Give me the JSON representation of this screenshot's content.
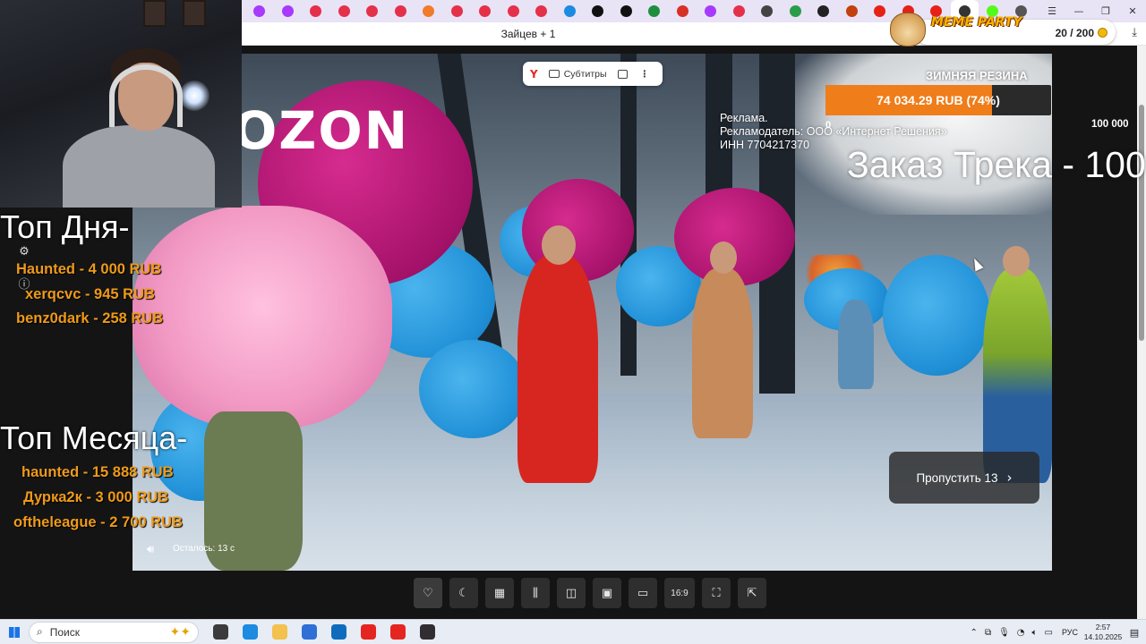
{
  "browser": {
    "window_title": "Зайцев + 1",
    "tabs": [
      {
        "icon": "wildberries-icon",
        "color": "#a73afd"
      },
      {
        "icon": "wildberries-icon",
        "color": "#a73afd"
      },
      {
        "icon": "ozon-icon",
        "color": "#e5304a"
      },
      {
        "icon": "ozon-icon",
        "color": "#e5304a"
      },
      {
        "icon": "ozon-icon",
        "color": "#e5304a"
      },
      {
        "icon": "ozon-icon",
        "color": "#e5304a"
      },
      {
        "icon": "megamarket-icon",
        "color": "#f07c2b"
      },
      {
        "icon": "ozon-icon",
        "color": "#e5304a"
      },
      {
        "icon": "ozon-icon",
        "color": "#e5304a"
      },
      {
        "icon": "ozon-icon",
        "color": "#e5304a"
      },
      {
        "icon": "ozon-icon",
        "color": "#e5304a"
      },
      {
        "icon": "edge-icon",
        "color": "#1c8be0"
      },
      {
        "icon": "circle-icon",
        "color": "#111111"
      },
      {
        "icon": "circle-icon",
        "color": "#111111"
      },
      {
        "icon": "sheets-icon",
        "color": "#1e8e3e"
      },
      {
        "icon": "plus-cross-icon",
        "color": "#d93025"
      },
      {
        "icon": "wildberries-icon",
        "color": "#a73afd"
      },
      {
        "icon": "ozon-icon",
        "color": "#e5304a"
      },
      {
        "icon": "globe-icon",
        "color": "#444444"
      },
      {
        "icon": "check-icon",
        "color": "#2a9d4a"
      },
      {
        "icon": "letter-r-icon",
        "color": "#222222"
      },
      {
        "icon": "chart-icon",
        "color": "#c2410c"
      },
      {
        "icon": "youtube-icon",
        "color": "#e62117"
      },
      {
        "icon": "youtube-icon",
        "color": "#e62117"
      },
      {
        "icon": "youtube-icon",
        "color": "#e62117"
      },
      {
        "icon": "twitch-icon",
        "color": "#333333"
      },
      {
        "icon": "kick-icon",
        "color": "#53fc18"
      },
      {
        "icon": "new-tab-plus-icon",
        "color": "#555555"
      }
    ],
    "window_controls": {
      "menu": "☰",
      "minimize": "—",
      "restore": "❐",
      "close": "✕"
    },
    "download_icon": "⤓"
  },
  "video_controls_top": {
    "subtitles_label": "Субтитры"
  },
  "ad": {
    "brand_logo": "OZON",
    "disclosure_lines": [
      "Реклама.",
      "Рекламодатель: ООО «Интернет Решения»",
      "ИНН 7704217370"
    ],
    "skip_label": "Пропустить 13",
    "remaining_label": "Осталось: 13 с"
  },
  "player_controls": [
    {
      "name": "like-heart-icon",
      "glyph": "♡"
    },
    {
      "name": "night-mode-moon-icon",
      "glyph": "☾"
    },
    {
      "name": "grid-icon",
      "glyph": "▦"
    },
    {
      "name": "audio-wave-icon",
      "glyph": "⫼"
    },
    {
      "name": "mirror-icon",
      "glyph": "◫"
    },
    {
      "name": "picture-in-picture-icon",
      "glyph": "▣"
    },
    {
      "name": "mini-player-icon",
      "glyph": "▭"
    },
    {
      "name": "aspect-ratio-button",
      "glyph": "16:9"
    },
    {
      "name": "fullscreen-icon",
      "glyph": "⛶"
    },
    {
      "name": "open-external-icon",
      "glyph": "⇱"
    }
  ],
  "stream_overlay": {
    "meme_party": {
      "brand": "MEME PARTY",
      "count": "20 / 200"
    },
    "goal": {
      "title": "ЗИМНЯЯ РЕЗИНА",
      "amount_text": "74 034.29 RUB (74%)",
      "progress": 0.74,
      "min_label": "0",
      "max_label": "100 000",
      "fill_color": "#ef7d1a"
    },
    "track_order": "Заказ Трека - 100",
    "top_day": {
      "heading": "Топ Дня-",
      "rows": [
        "Haunted - 4 000 RUB",
        "xerqcvc - 945 RUB",
        "benz0dark - 258 RUB"
      ]
    },
    "top_month": {
      "heading": "Топ Месяца-",
      "rows": [
        "haunted - 15 888 RUB",
        "Дурка2к - 3 000 RUB",
        "oftheleague - 2 700 RUB"
      ]
    },
    "text_color": "#ef9a1a"
  },
  "taskbar": {
    "search_placeholder": "Поиск",
    "apps": [
      {
        "name": "task-view-icon",
        "color": "#3b3b3b"
      },
      {
        "name": "edge-browser-icon",
        "color": "#1c8be0"
      },
      {
        "name": "file-explorer-icon",
        "color": "#f2c14e"
      },
      {
        "name": "microsoft-store-icon",
        "color": "#2f6fd6"
      },
      {
        "name": "outlook-icon",
        "color": "#0f6cbd"
      },
      {
        "name": "yandex-browser-icon",
        "color": "#e52620"
      },
      {
        "name": "yandex-icon",
        "color": "#e52620"
      },
      {
        "name": "obs-studio-icon",
        "color": "#302e31"
      }
    ],
    "tray": {
      "language": "РУС",
      "time": "2:57",
      "date": "14.10.2025"
    }
  }
}
